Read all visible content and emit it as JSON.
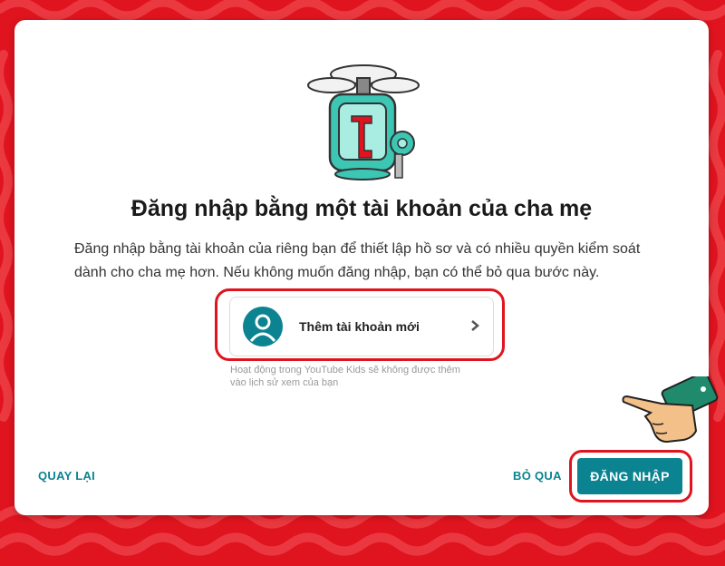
{
  "dialog": {
    "title": "Đăng nhập bằng một tài khoản của cha mẹ",
    "description": "Đăng nhập bằng tài khoản của riêng bạn để thiết lập hồ sơ và có nhiều quyền kiểm soát dành cho cha mẹ hơn. Nếu không muốn đăng nhập, bạn có thể bỏ qua bước này.",
    "add_account": {
      "label": "Thêm tài khoản mới",
      "avatar_icon": "account-circle-icon",
      "chevron_icon": "chevron-right-icon"
    },
    "history_note": "Hoạt động trong YouTube Kids sẽ không được thêm vào lịch sử xem của bạn",
    "back_label": "QUAY LẠI",
    "skip_label": "BỎ QUA",
    "login_label": "ĐĂNG NHẬP"
  },
  "colors": {
    "background": "#e0141e",
    "accent": "#0b8391",
    "highlight": "#e0141e"
  }
}
